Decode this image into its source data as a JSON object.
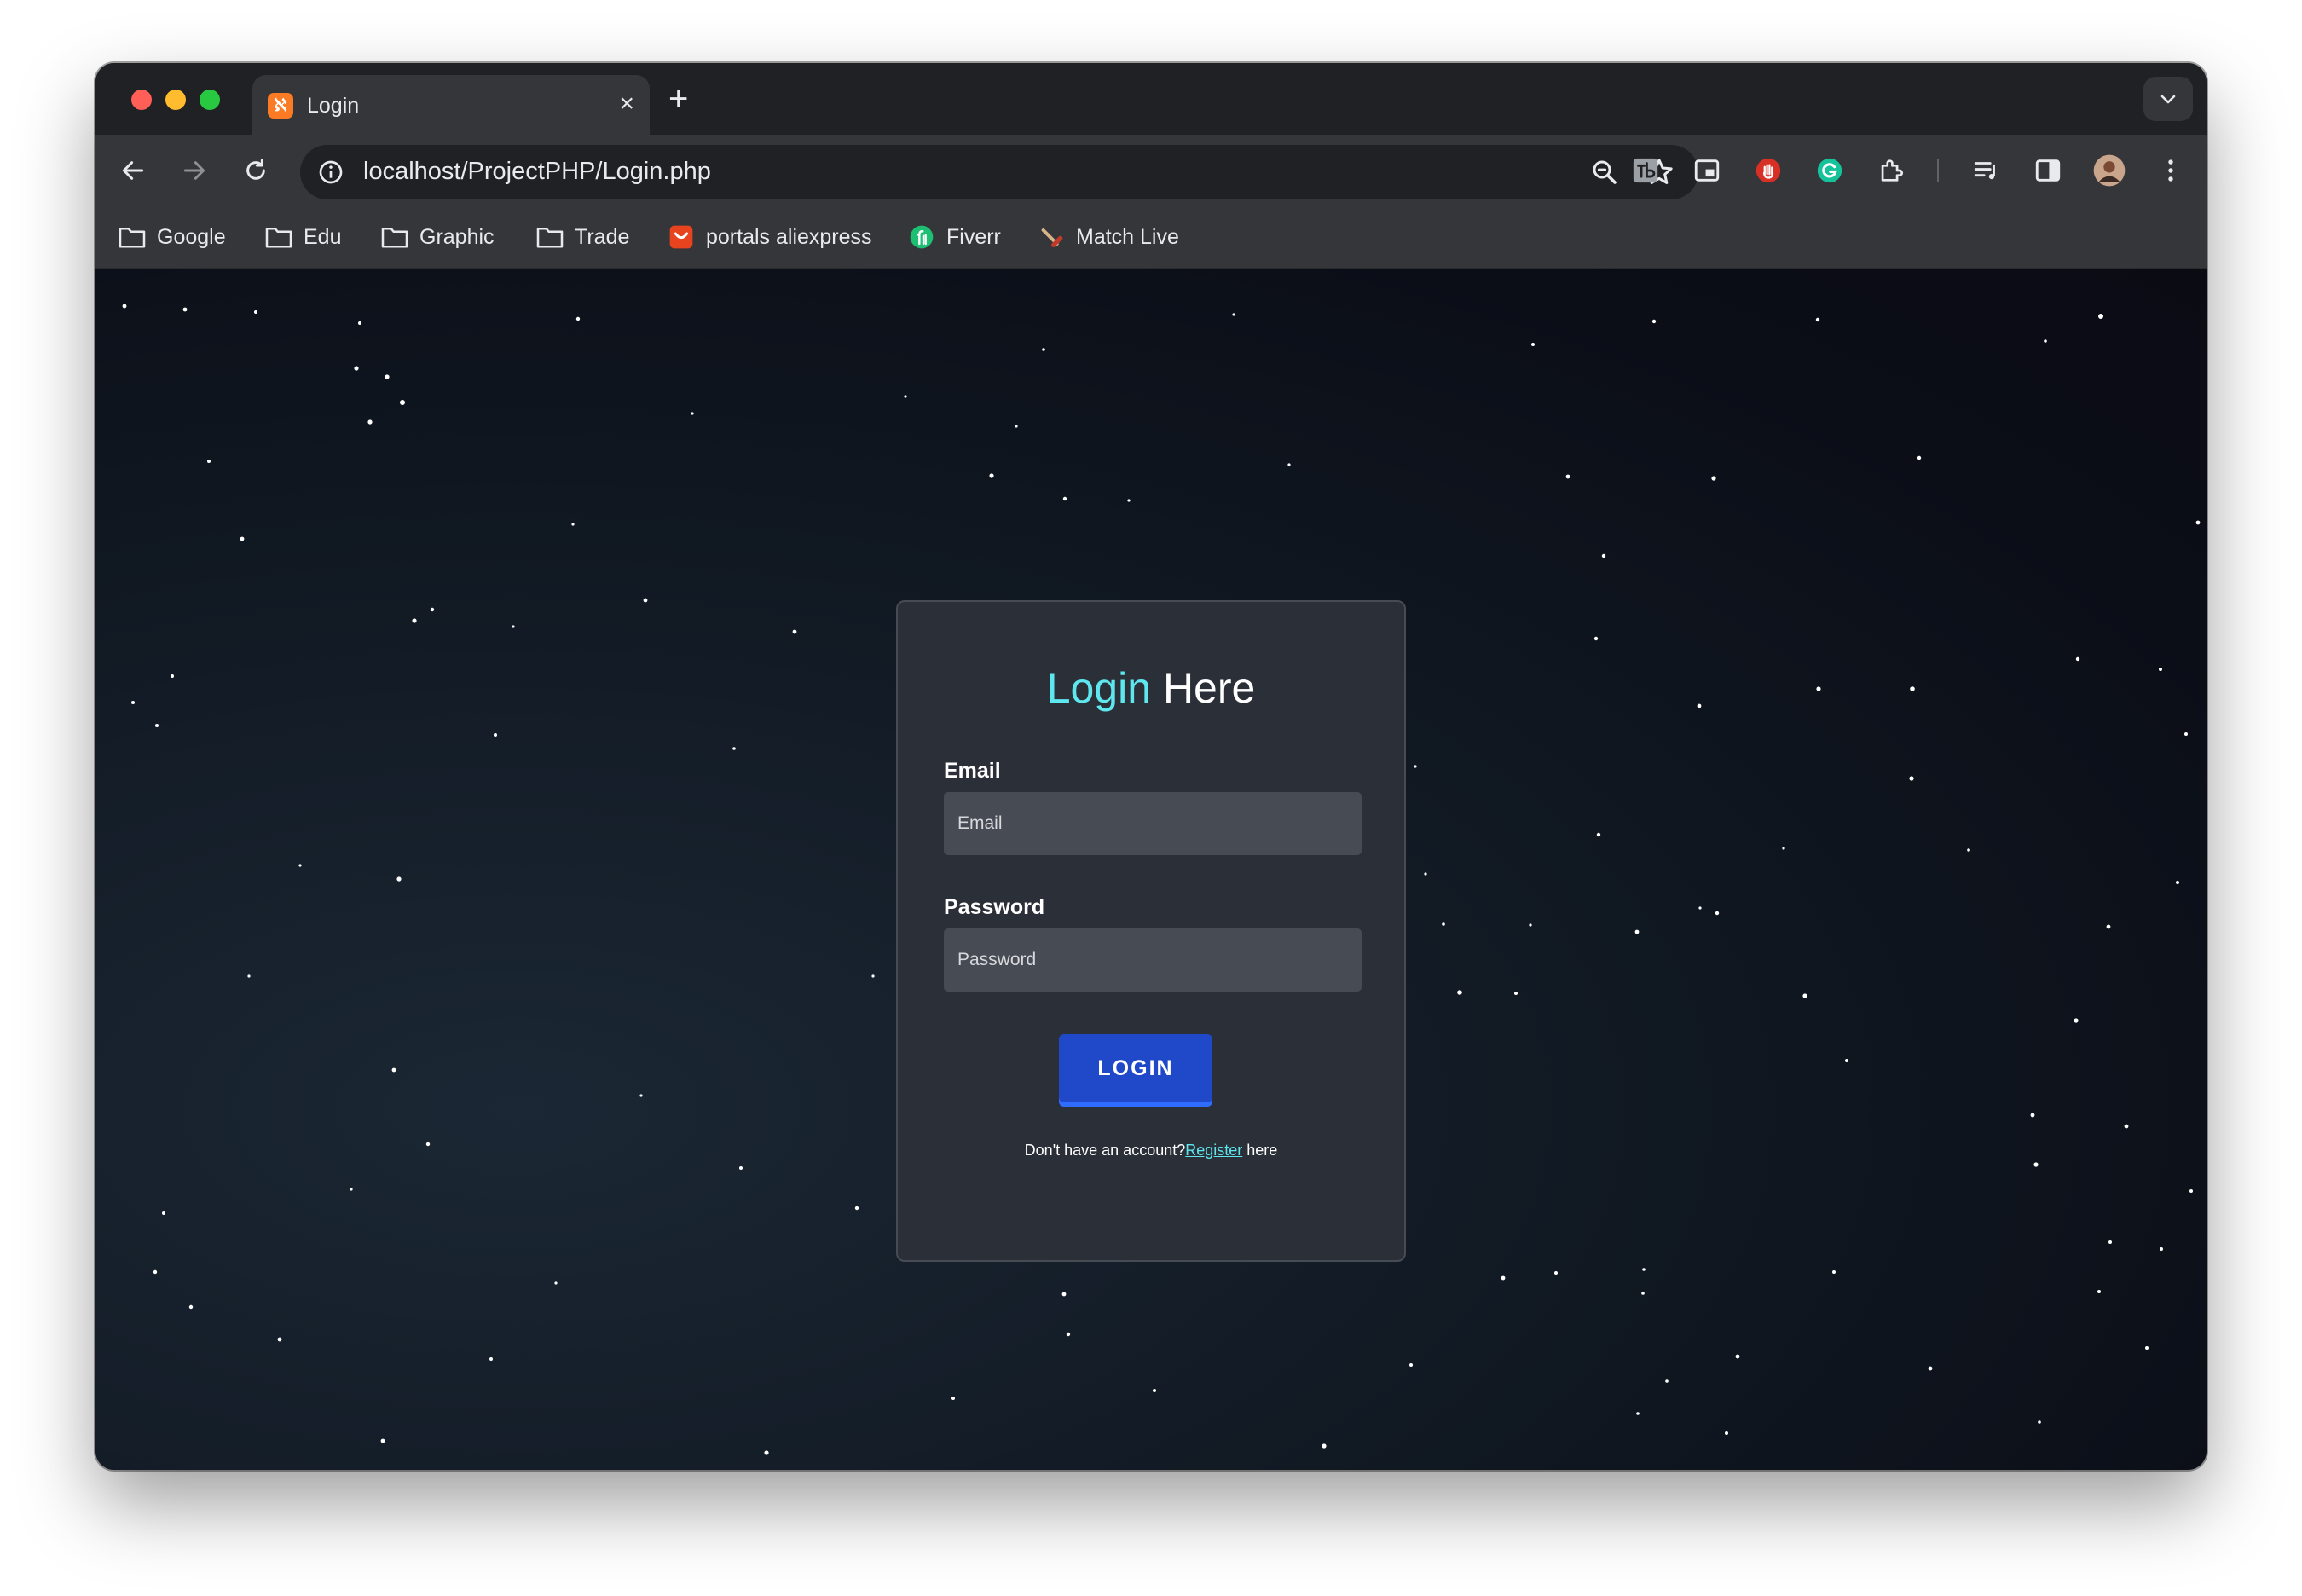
{
  "browser": {
    "tab": {
      "title": "Login",
      "favicon": "xampp-icon",
      "close_glyph": "×"
    },
    "new_tab_glyph": "+",
    "address": {
      "url": "localhost/ProjectPHP/Login.php"
    },
    "bookmarks": [
      {
        "label": "Google",
        "icon": "folder-icon"
      },
      {
        "label": "Edu",
        "icon": "folder-icon"
      },
      {
        "label": "Graphic",
        "icon": "folder-icon"
      },
      {
        "label": "Trade",
        "icon": "folder-icon"
      },
      {
        "label": "portals aliexpress",
        "icon": "aliexpress-icon"
      },
      {
        "label": "Fiverr",
        "icon": "fiverr-icon"
      },
      {
        "label": "Match Live",
        "icon": "match-live-icon"
      }
    ]
  },
  "login": {
    "title_accent": "Login",
    "title_rest": "Here",
    "email_label": "Email",
    "email_placeholder": "Email",
    "email_value": "",
    "password_label": "Password",
    "password_placeholder": "Password",
    "password_value": "",
    "button_label": "LOGIN",
    "register_prefix": "Don't have an account?",
    "register_link": "Register",
    "register_suffix": " here"
  },
  "colors": {
    "accent": "#5ee7ef",
    "button": "#1f49c9",
    "card": "#2b2f38",
    "background": "#0f1622"
  }
}
